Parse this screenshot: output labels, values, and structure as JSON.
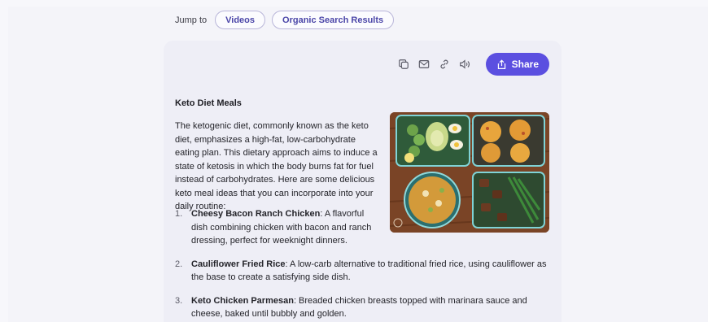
{
  "jump": {
    "label": "Jump to",
    "links": [
      "Videos",
      "Organic Search Results"
    ]
  },
  "toolbar": {
    "icons": [
      "copy-icon",
      "mail-icon",
      "link-icon",
      "speaker-icon"
    ],
    "share_label": "Share"
  },
  "article": {
    "title": "Keto Diet Meals",
    "intro": "The ketogenic diet, commonly known as the keto diet, emphasizes a high-fat, low-carbohydrate eating plan. This dietary approach aims to induce a state of ketosis in which the body burns fat for fuel instead of carbohydrates. Here are some delicious keto meal ideas that you can incorporate into your daily routine:",
    "items": [
      {
        "num": "1.",
        "name": "Cheesy Bacon Ranch Chicken",
        "desc": ": A flavorful dish combining chicken with bacon and ranch dressing, perfect for weeknight dinners."
      },
      {
        "num": "2.",
        "name": "Cauliflower Fried Rice",
        "desc": ": A low-carb alternative to traditional fried rice, using cauliflower as the base to create a satisfying side dish."
      },
      {
        "num": "3.",
        "name": "Keto Chicken Parmesan",
        "desc": ": Breaded chicken breasts topped with marinara sauce and cheese, baked until bubbly and golden."
      }
    ]
  },
  "colors": {
    "accent": "#5b4fe0",
    "pill_text": "#4b46a8"
  }
}
